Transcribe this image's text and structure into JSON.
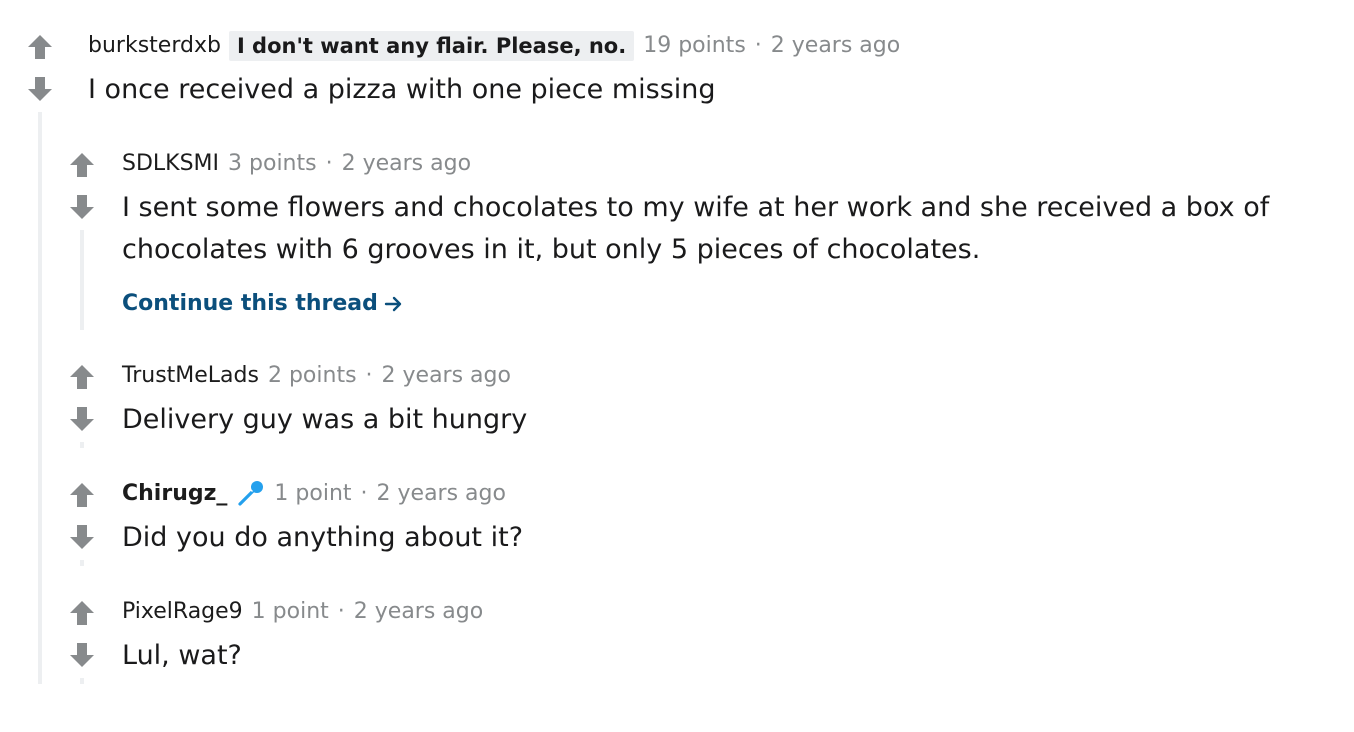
{
  "colors": {
    "arrow": "#878a8c",
    "thread_line": "#edeff1",
    "link": "#0b4f7c",
    "meta": "#878a8c",
    "mic_icon": "#24a0ed"
  },
  "comments": [
    {
      "author": "burksterdxb",
      "flair": "I don't want any flair. Please, no.",
      "points": "19 points",
      "separator": "·",
      "time": "2 years ago",
      "body": "I once received a pizza with one piece missing"
    },
    {
      "author": "SDLKSMI",
      "points": "3 points",
      "separator": "·",
      "time": "2 years ago",
      "body_line_1": "I sent some flowers and chocolates to my wife at her work and she received a box of",
      "body_line_2": "chocolates with 6 grooves in it, but only 5 pieces of chocolates.",
      "continue_label": "Continue this thread"
    },
    {
      "author": "TrustMeLads",
      "points": "2 points",
      "separator": "·",
      "time": "2 years ago",
      "body": "Delivery guy was a bit hungry"
    },
    {
      "author": "Chirugz_",
      "author_icon": "microphone-icon",
      "points": "1 point",
      "separator": "·",
      "time": "2 years ago",
      "body": "Did you do anything about it?"
    },
    {
      "author": "PixelRage9",
      "points": "1 point",
      "separator": "·",
      "time": "2 years ago",
      "body": "Lul, wat?"
    }
  ]
}
